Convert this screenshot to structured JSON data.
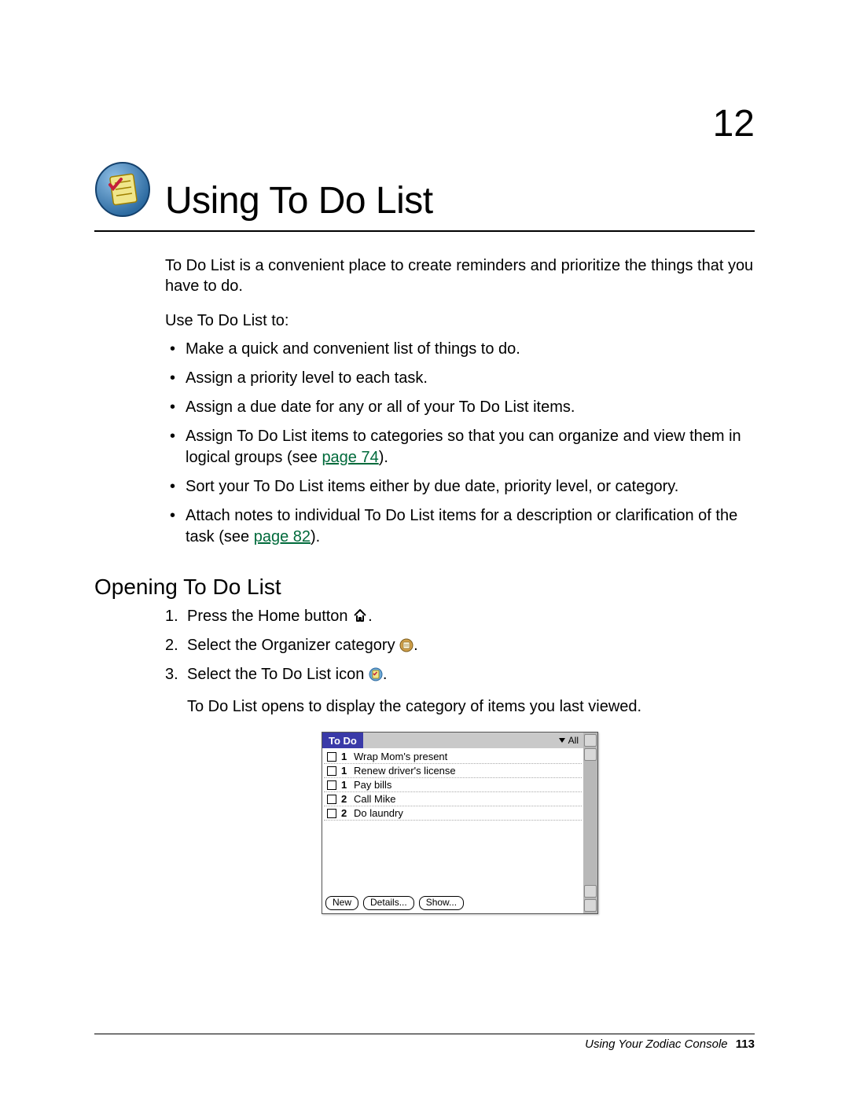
{
  "chapter": {
    "number": "12",
    "title": "Using To Do List"
  },
  "intro": {
    "p1": "To Do List is a convenient place to create reminders and prioritize the things that you have to do.",
    "p2": "Use To Do List to:",
    "bullets": [
      {
        "text": "Make a quick and convenient list of things to do."
      },
      {
        "text": "Assign a priority level to each task."
      },
      {
        "text": "Assign a due date for any or all of your To Do List items."
      },
      {
        "text_pre": "Assign To Do List items to categories so that you can organize and view them in logical groups (see ",
        "link": "page 74",
        "text_post": ")."
      },
      {
        "text": "Sort your To Do List items either by due date, priority level, or category."
      },
      {
        "text_pre": "Attach notes to individual To Do List items for a description or clarification of the task (see ",
        "link": "page 82",
        "text_post": ")."
      }
    ]
  },
  "section_opening": {
    "heading": "Opening To Do List",
    "steps": [
      {
        "pre": "Press the Home button ",
        "icon": "home-icon",
        "post": "."
      },
      {
        "pre": "Select the Organizer category ",
        "icon": "organizer-icon",
        "post": "."
      },
      {
        "pre": "Select the To Do List icon ",
        "icon": "todo-icon",
        "post": "."
      }
    ],
    "result": "To Do List opens to display the category of items you last viewed."
  },
  "screenshot": {
    "title": "To Do",
    "filter": "All",
    "items": [
      {
        "priority": "1",
        "text": "Wrap Mom's present"
      },
      {
        "priority": "1",
        "text": "Renew driver's license"
      },
      {
        "priority": "1",
        "text": "Pay bills"
      },
      {
        "priority": "2",
        "text": "Call Mike"
      },
      {
        "priority": "2",
        "text": "Do laundry"
      }
    ],
    "buttons": {
      "new": "New",
      "details": "Details...",
      "show": "Show..."
    }
  },
  "footer": {
    "book": "Using Your Zodiac Console",
    "page": "113"
  }
}
